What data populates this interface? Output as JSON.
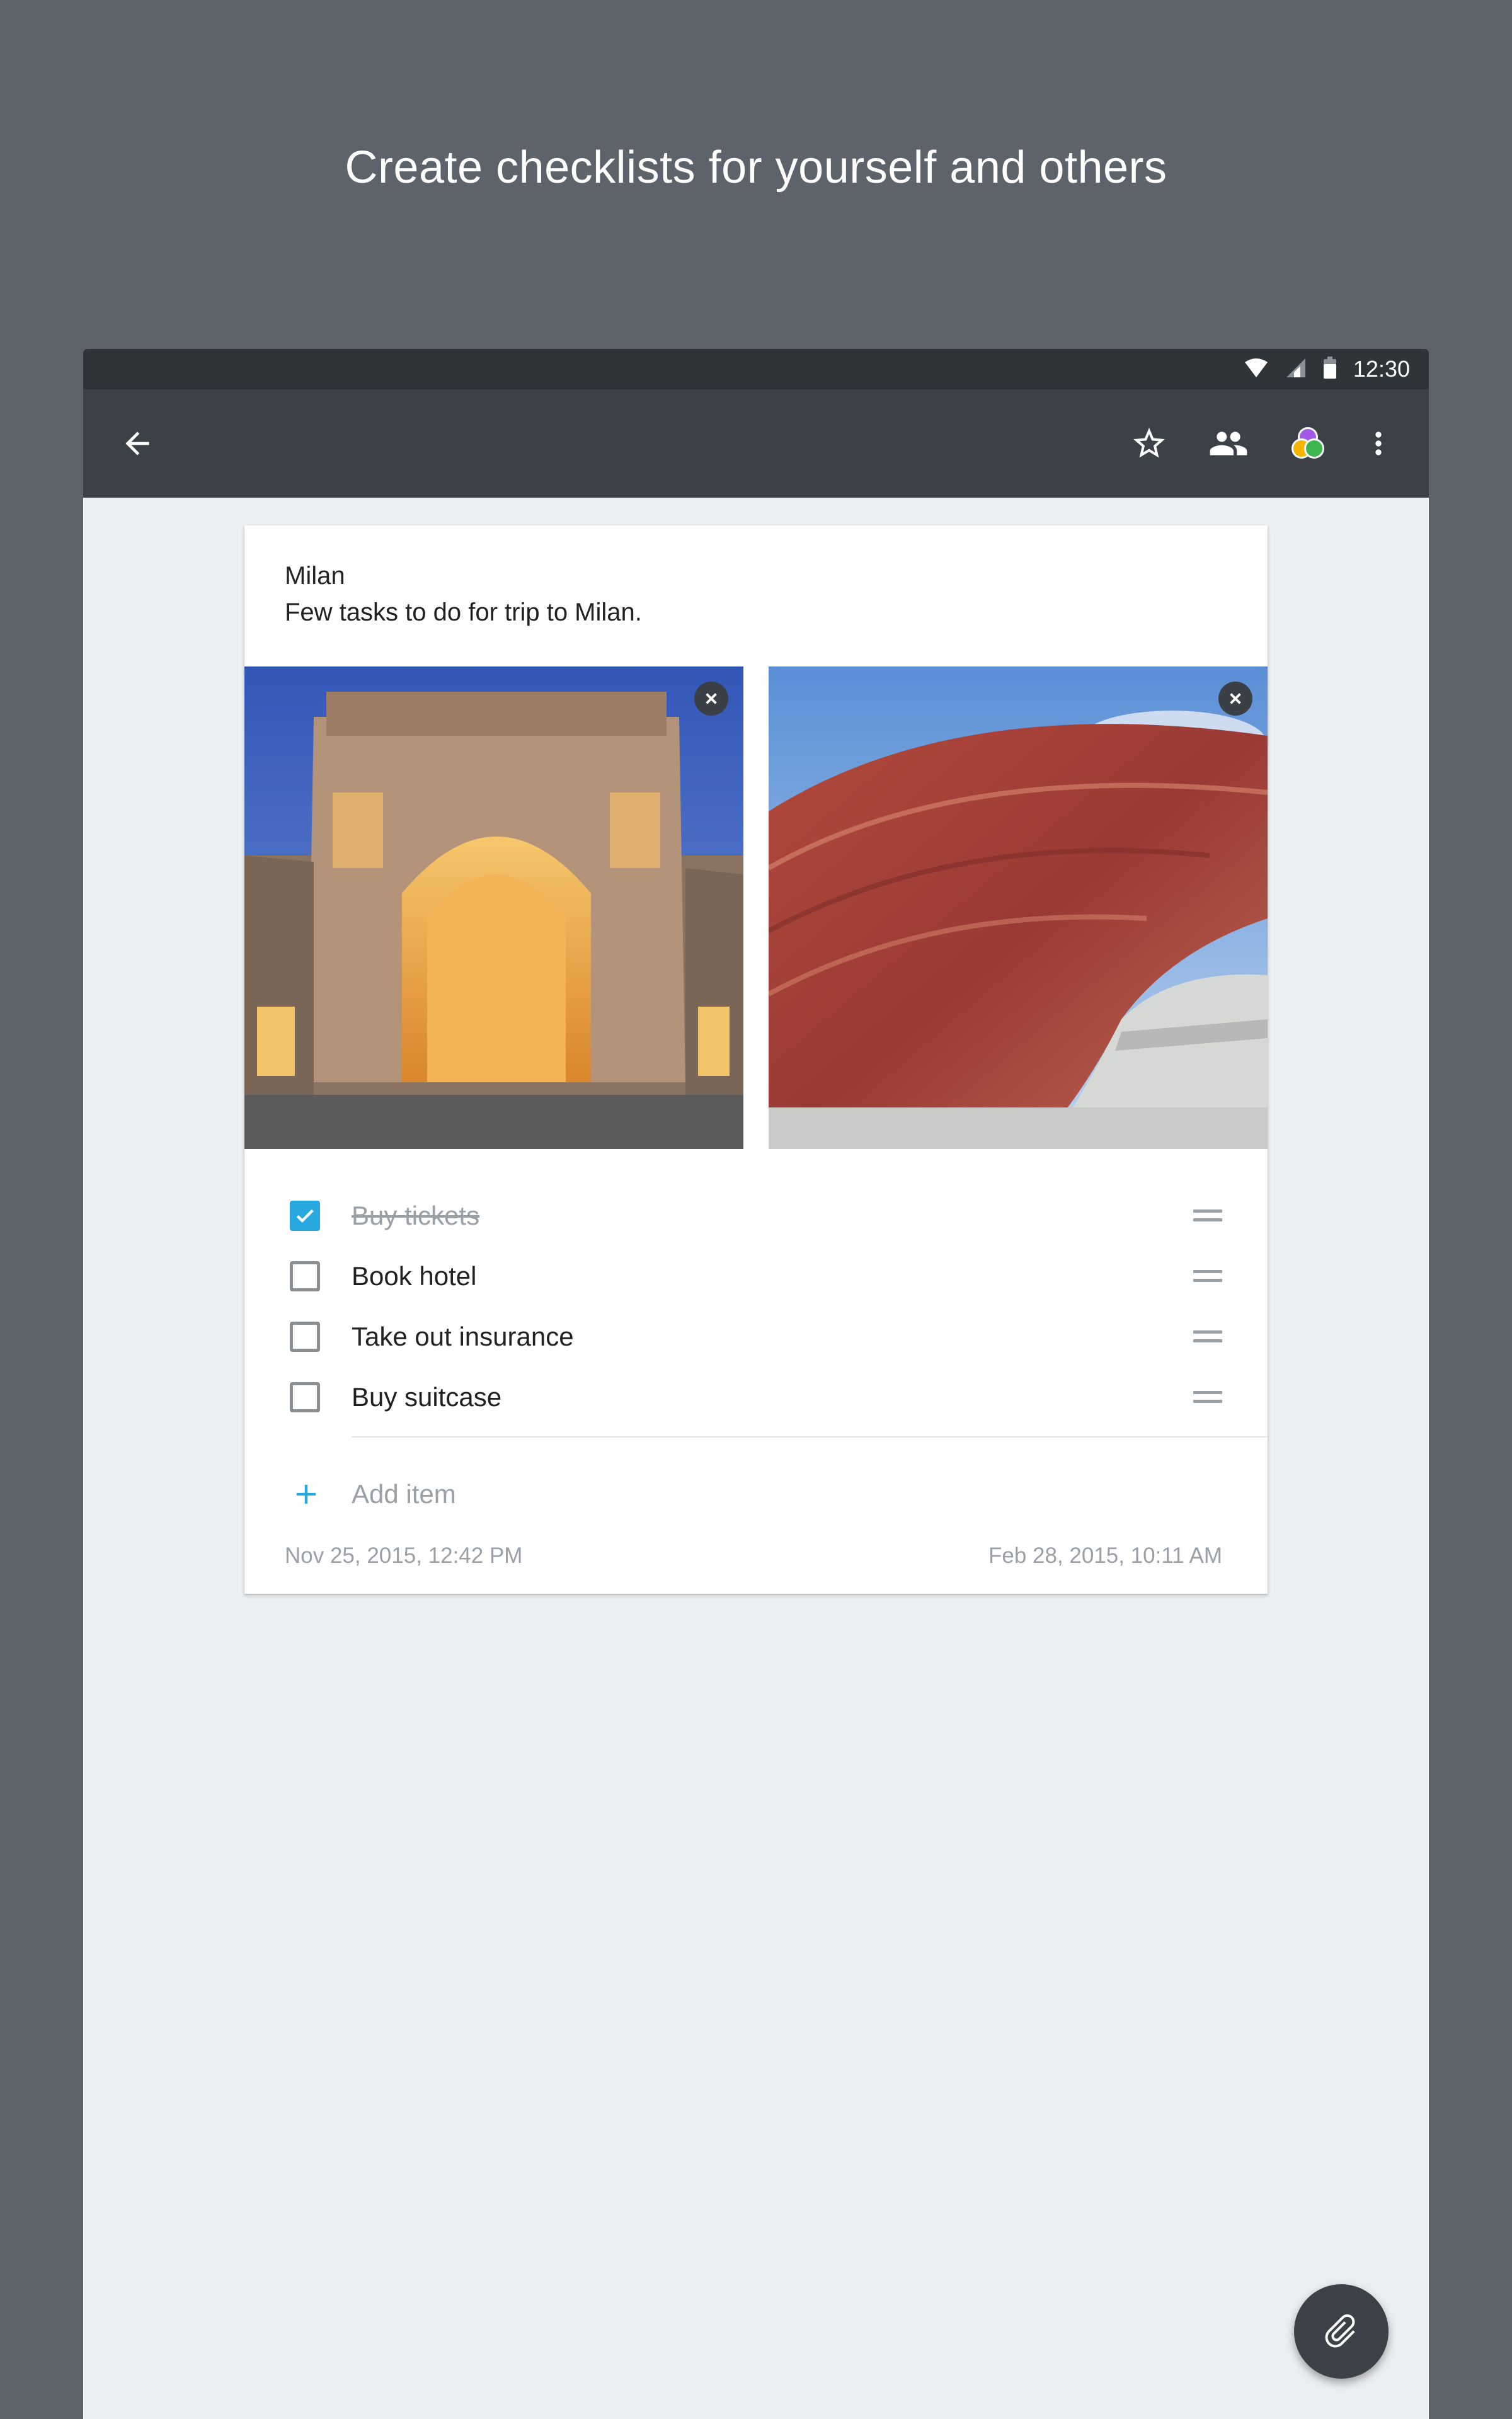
{
  "headline": "Create checklists for yourself and others",
  "status_bar": {
    "time": "12:30",
    "icons": [
      "wifi-icon",
      "signal-icon",
      "battery-icon"
    ]
  },
  "app_bar": {
    "icons": [
      "back-arrow-icon",
      "star-icon",
      "people-icon",
      "color-palette-icon",
      "more-vert-icon"
    ]
  },
  "note": {
    "title": "Milan",
    "description": "Few tasks to do for trip to Milan.",
    "images": [
      "galleria-arcade-photo",
      "red-pavilion-photo"
    ],
    "checklist": [
      {
        "label": "Buy tickets",
        "checked": true
      },
      {
        "label": "Book hotel",
        "checked": false
      },
      {
        "label": "Take out insurance",
        "checked": false
      },
      {
        "label": "Buy suitcase",
        "checked": false
      }
    ],
    "add_item_label": "Add item",
    "created_date": "Nov 25, 2015, 12:42 PM",
    "modified_date": "Feb 28, 2015, 10:11 AM"
  },
  "fab": {
    "icon": "attachment-icon"
  },
  "colors": {
    "background": "#5c636b",
    "app_bar": "#3c4147",
    "status_bar": "#2f3438",
    "accent": "#29a8e0",
    "content_background": "#eceff1"
  }
}
